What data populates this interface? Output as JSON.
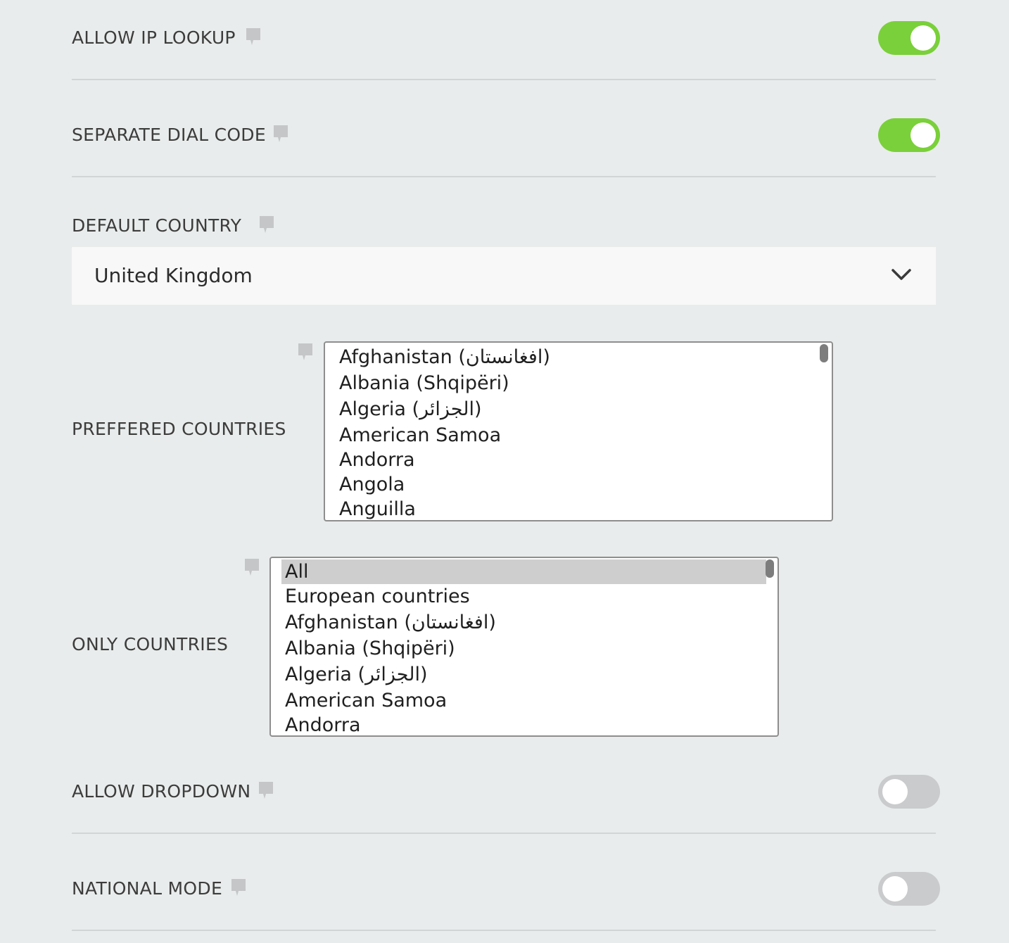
{
  "settings": {
    "allow_ip_lookup": {
      "label": "ALLOW IP LOOKUP",
      "enabled": true
    },
    "separate_dial_code": {
      "label": "SEPARATE DIAL CODE",
      "enabled": true
    },
    "default_country": {
      "label": "DEFAULT COUNTRY",
      "value": "United Kingdom"
    },
    "preferred_countries": {
      "label": "PREFFERED COUNTRIES",
      "options": [
        "Afghanistan (‫افغانستان‬‎)",
        "Albania (Shqipëri)",
        "Algeria (‫الجزائر‬‎)",
        "American Samoa",
        "Andorra",
        "Angola",
        "Anguilla"
      ]
    },
    "only_countries": {
      "label": "ONLY COUNTRIES",
      "selected": "All",
      "options": [
        "All",
        "European countries",
        "Afghanistan (‫افغانستان‬‎)",
        "Albania (Shqipëri)",
        "Algeria (‫الجزائر‬‎)",
        "American Samoa",
        "Andorra"
      ]
    },
    "allow_dropdown": {
      "label": "ALLOW DROPDOWN",
      "enabled": false
    },
    "national_mode": {
      "label": "NATIONAL MODE",
      "enabled": false
    }
  },
  "icons": {
    "tooltip": "speech-bubble-icon",
    "dropdown": "chevron-down-icon"
  },
  "colors": {
    "background": "#e9ecec",
    "toggle_on": "#7ad03a",
    "toggle_off": "#c9cbcd",
    "tooltip_icon": "#c4c6c7"
  }
}
